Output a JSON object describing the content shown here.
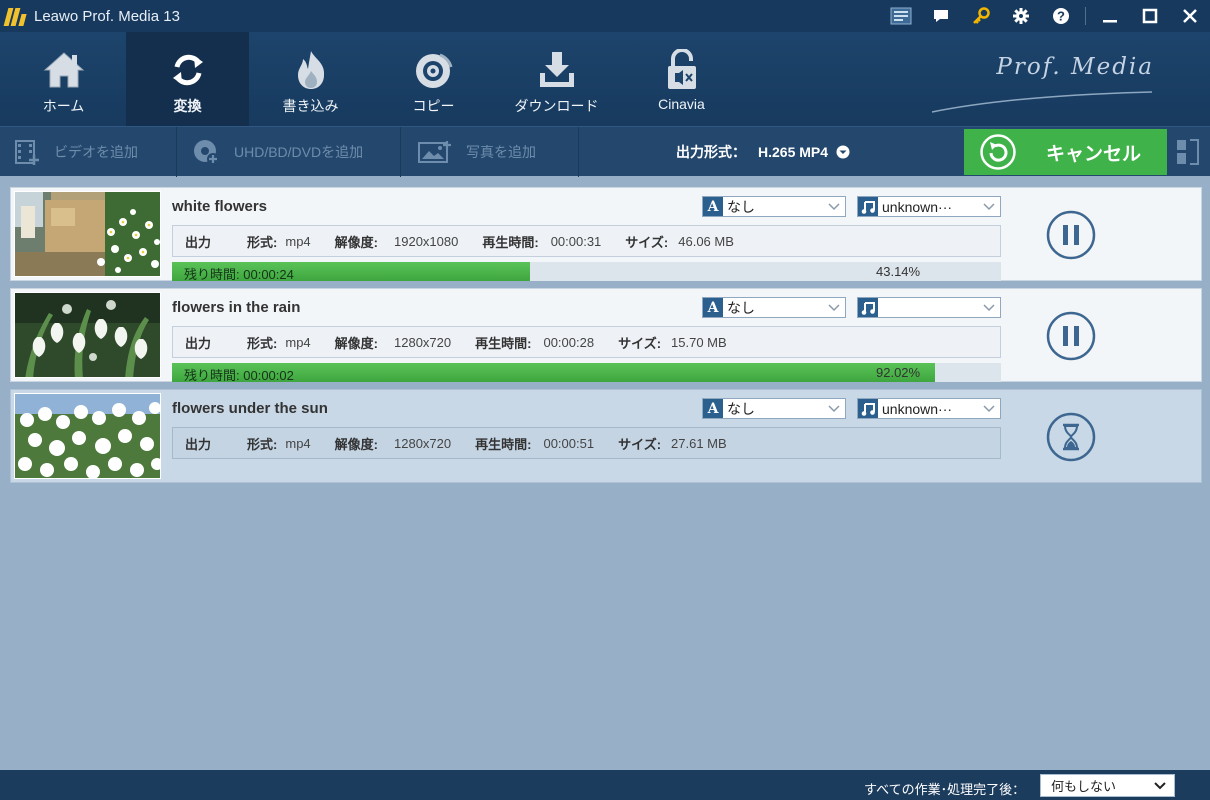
{
  "window": {
    "title": "Leawo Prof. Media 13"
  },
  "nav": {
    "items": [
      {
        "label": "ホーム",
        "icon": "home-icon"
      },
      {
        "label": "変換",
        "icon": "convert-icon",
        "active": true
      },
      {
        "label": "書き込み",
        "icon": "burn-icon"
      },
      {
        "label": "コピー",
        "icon": "copy-disc-icon"
      },
      {
        "label": "ダウンロード",
        "icon": "download-icon"
      },
      {
        "label": "Cinavia",
        "icon": "cinavia-unlock-icon"
      }
    ],
    "brand": "Prof. Media"
  },
  "toolbar": {
    "add_video": "ビデオを追加",
    "add_disc": "UHD/BD/DVDを追加",
    "add_photo": "写真を追加",
    "format_label": "出力形式：",
    "format_value": "H.265 MP4",
    "cancel": "キャンセル"
  },
  "labels": {
    "output": "出力",
    "format": "形式:",
    "resolution": "解像度:",
    "duration": "再生時間:",
    "size": "サイズ:",
    "remaining": "残り時間:"
  },
  "tasks": [
    {
      "name": "white flowers",
      "subtitle": "なし",
      "audio": "unknown···",
      "format": "mp4",
      "resolution": "1920x1080",
      "duration": "00:00:31",
      "size": "46.06 MB",
      "remaining": "00:00:24",
      "progress": "43.14%",
      "progress_fraction": 0.4314,
      "state": "converting"
    },
    {
      "name": "flowers in the rain",
      "subtitle": "なし",
      "audio": "",
      "format": "mp4",
      "resolution": "1280x720",
      "duration": "00:00:28",
      "size": "15.70 MB",
      "remaining": "00:00:02",
      "progress": "92.02%",
      "progress_fraction": 0.9202,
      "state": "converting"
    },
    {
      "name": "flowers under the sun",
      "subtitle": "なし",
      "audio": "unknown···",
      "format": "mp4",
      "resolution": "1280x720",
      "duration": "00:00:51",
      "size": "27.61 MB",
      "state": "waiting"
    }
  ],
  "statusbar": {
    "after_label": "すべての作業･処理完了後：",
    "after_value": "何もしない"
  },
  "colors": {
    "title_bg": "#17395d",
    "nav_bg": "#1d446c",
    "toolbar_bg": "#24486d",
    "content_bg": "#97b0c8",
    "accent_green": "#3fb24a",
    "progress_green": "#4fb84f",
    "icon_blue": "#3d6791"
  }
}
